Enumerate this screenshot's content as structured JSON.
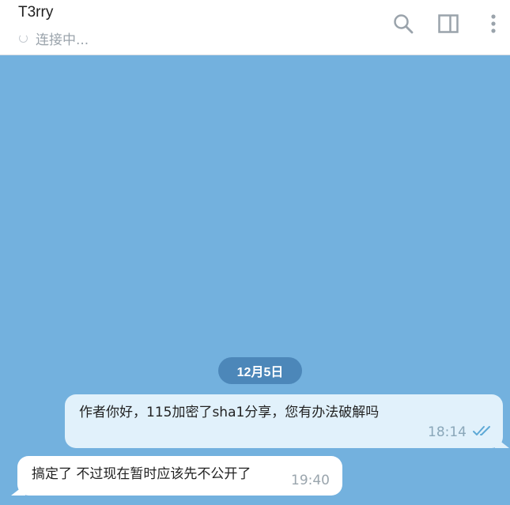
{
  "header": {
    "chat_title": "T3rry",
    "status_text": "连接中..."
  },
  "icons": {
    "search": "search-icon",
    "sidebar_toggle": "sidebar-toggle-icon",
    "more": "more-vertical-icon"
  },
  "colors": {
    "chat_background": "#73b1de",
    "date_pill": "#4c87b9",
    "outgoing_bubble": "#e1f1fb",
    "incoming_bubble": "#ffffff",
    "read_checks": "#5ea9d6"
  },
  "messages": {
    "date_label": "12月5日",
    "outgoing": {
      "text": "作者你好，115加密了sha1分享，您有办法破解吗",
      "time": "18:14",
      "status": "read"
    },
    "incoming": {
      "text": "搞定了 不过现在暂时应该先不公开了",
      "time": "19:40"
    }
  }
}
